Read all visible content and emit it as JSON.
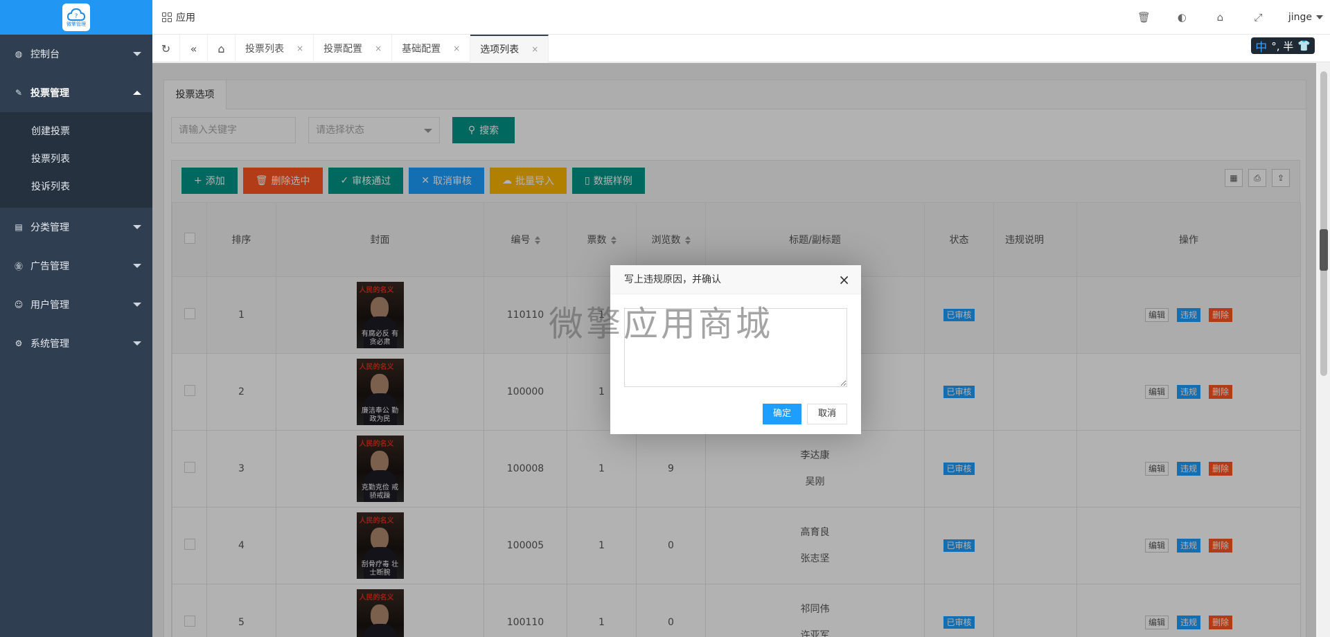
{
  "sidebar": {
    "logo_text": "微擎管理",
    "items": [
      {
        "label": "控制台",
        "icon": "globe-icon"
      },
      {
        "label": "投票管理",
        "icon": "edit-icon",
        "children": [
          "创建投票",
          "投票列表",
          "投诉列表"
        ]
      },
      {
        "label": "分类管理",
        "icon": "list-icon"
      },
      {
        "label": "广告管理",
        "icon": "ad-icon"
      },
      {
        "label": "用户管理",
        "icon": "user-icon"
      },
      {
        "label": "系统管理",
        "icon": "gear-icon"
      }
    ]
  },
  "header": {
    "app_label": "应用",
    "user": "jinge",
    "icons": [
      "trash-icon",
      "palette-icon",
      "tag-icon",
      "fullscreen-icon"
    ]
  },
  "tabs": {
    "items": [
      "投票列表",
      "投票配置",
      "基础配置",
      "选项列表"
    ],
    "active": "选项列表",
    "close": "×"
  },
  "ime": {
    "zh": "中",
    "text": "°, 半",
    "shirt": "👕"
  },
  "card": {
    "tab_label": "投票选项",
    "keyword_placeholder": "请输入关键字",
    "status_placeholder": "请选择状态",
    "search_label": "搜索"
  },
  "toolbar": {
    "add": "添加",
    "delete_selected": "删除选中",
    "approve": "审核通过",
    "cancel_review": "取消审核",
    "batch_import": "批量导入",
    "data_sample": "数据样例"
  },
  "table": {
    "columns": [
      "排序",
      "封面",
      "编号",
      "票数",
      "浏览数",
      "标题/副标题",
      "状态",
      "违规说明",
      "操作"
    ],
    "rows": [
      {
        "sort": "1",
        "code": "110110",
        "votes": "1",
        "views": "",
        "title": "",
        "subtitle": "",
        "slogan": "有腐必反 有贪必肃",
        "status": "已审核"
      },
      {
        "sort": "2",
        "code": "100000",
        "votes": "1",
        "views": "",
        "title": "",
        "subtitle": "",
        "slogan": "廉洁奉公 勤政为民",
        "status": "已审核"
      },
      {
        "sort": "3",
        "code": "100008",
        "votes": "1",
        "views": "9",
        "title": "李达康",
        "subtitle": "吴刚",
        "slogan": "克勤克俭 戒骄戒躁",
        "status": "已审核"
      },
      {
        "sort": "4",
        "code": "100005",
        "votes": "1",
        "views": "0",
        "title": "高育良",
        "subtitle": "张志坚",
        "slogan": "刮骨疗毒 壮士断腕",
        "status": "已审核"
      },
      {
        "sort": "5",
        "code": "100110",
        "votes": "1",
        "views": "0",
        "title": "祁同伟",
        "subtitle": "许亚军",
        "slogan": "",
        "status": "已审核"
      }
    ],
    "magazine_title": "人民的名义",
    "op_edit": "编辑",
    "op_violate": "违规",
    "op_delete": "删除"
  },
  "dialog": {
    "title": "写上违规原因，并确认",
    "ok": "确定",
    "cancel": "取消",
    "textarea_value": ""
  },
  "watermark": "微擎应用商城",
  "colors": {
    "sidebar_bg": "#2f3e50",
    "brand": "#2196f3",
    "green": "#009688",
    "red": "#ff5722",
    "blue": "#1e9fff",
    "yellow": "#ffb800"
  }
}
